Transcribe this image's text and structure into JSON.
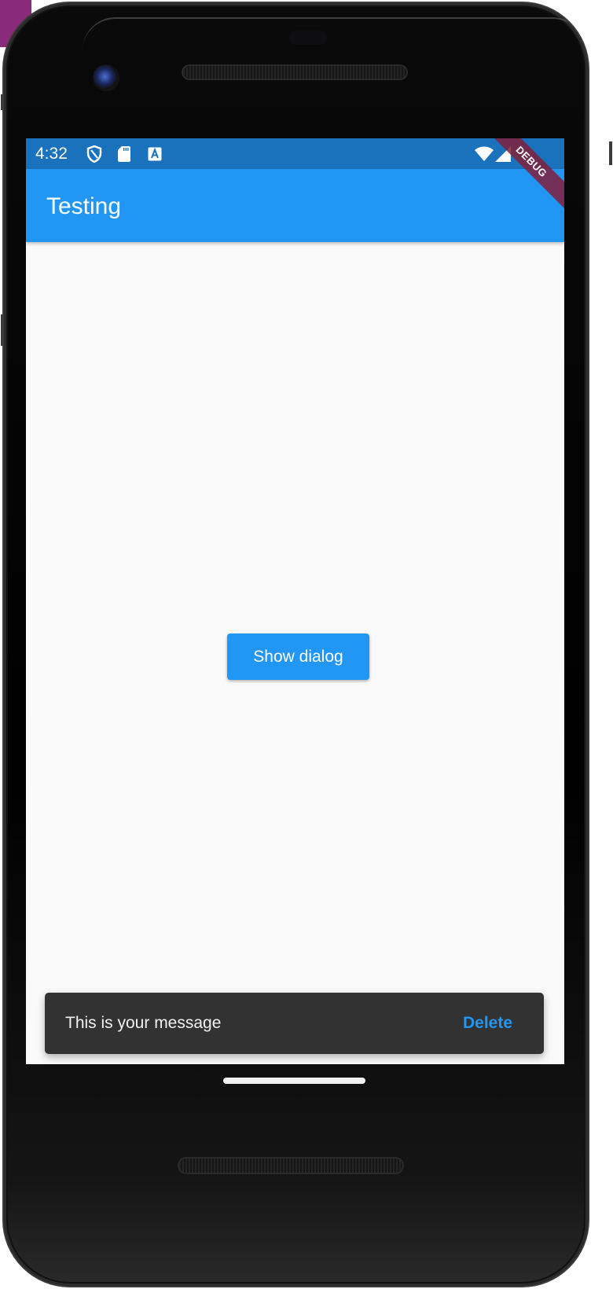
{
  "status_bar": {
    "time": "4:32",
    "left_icons": [
      "shield-icon",
      "sd-card-icon",
      "keyboard-a-icon"
    ],
    "right_icons": [
      "wifi-icon",
      "cell-signal-icon"
    ]
  },
  "debug_banner": {
    "label": "DEBUG",
    "color": "#80203c"
  },
  "app_bar": {
    "title": "Testing",
    "color": "#2196f3"
  },
  "main": {
    "show_dialog_button": "Show dialog"
  },
  "snackbar": {
    "message": "This is your message",
    "action_label": "Delete",
    "background": "#323232",
    "action_color": "#2196f3"
  }
}
